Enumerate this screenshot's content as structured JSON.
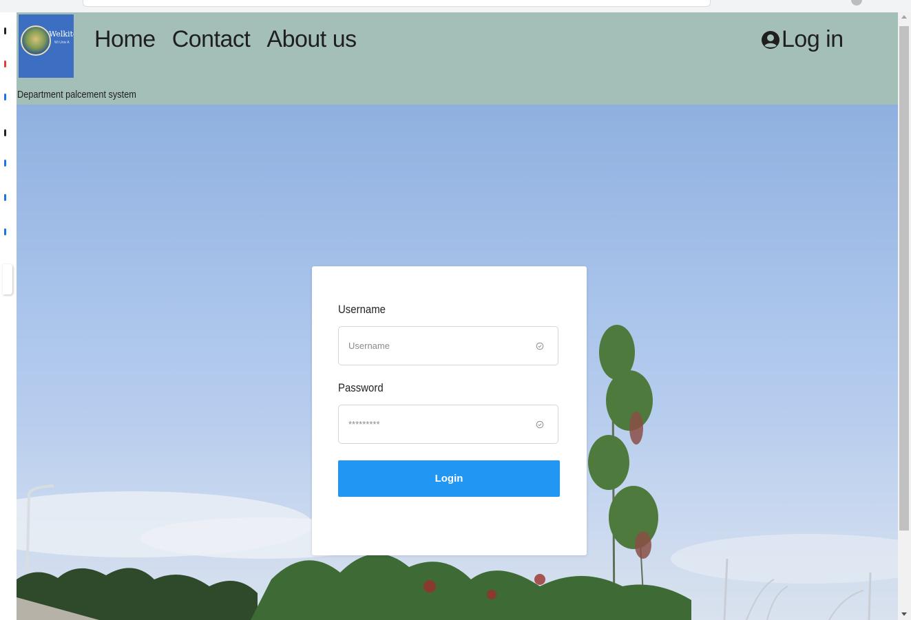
{
  "navbar": {
    "logo_text": "Welkite U",
    "logo_subtext": "Wi Univ A",
    "links": [
      {
        "label": "Home"
      },
      {
        "label": "Contact"
      },
      {
        "label": "About us"
      }
    ],
    "login_label": "Log in",
    "subtitle": "Department palcement system"
  },
  "login_form": {
    "username_label": "Username",
    "username_placeholder": "Username",
    "password_label": "Password",
    "password_placeholder": "*********",
    "submit_label": "Login"
  },
  "colors": {
    "navbar_bg": "#a3bfb8",
    "button_bg": "#2196f3",
    "logo_bg": "#3c6fc2"
  },
  "icons": {
    "user": "user-circle-icon",
    "field_status": "check-circle-icon"
  }
}
